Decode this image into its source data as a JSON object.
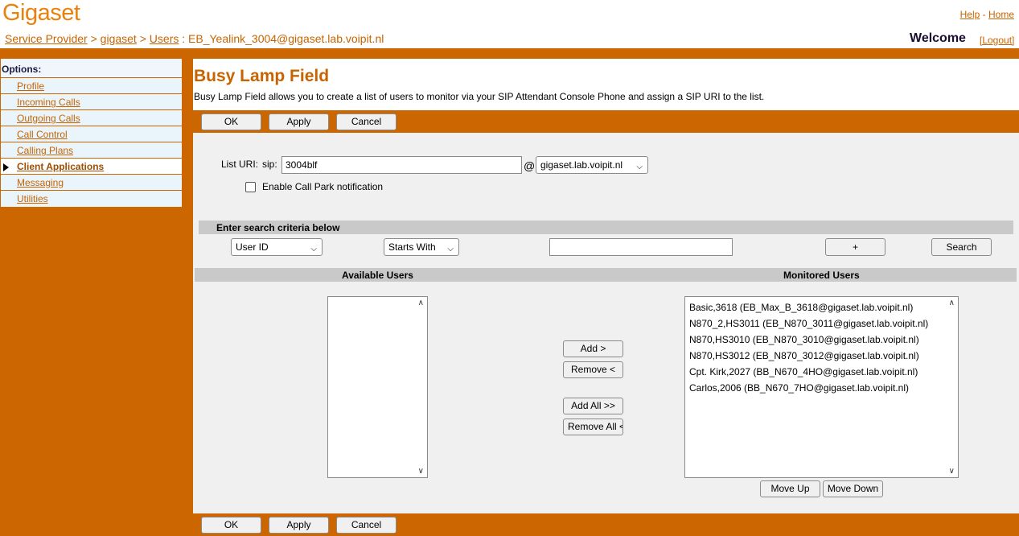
{
  "brand": {
    "logo_text": "Gigaset"
  },
  "top_links": {
    "help": "Help",
    "separator": "-",
    "home": "Home"
  },
  "breadcrumb": {
    "service_provider": "Service Provider",
    "sep1": ">",
    "gigaset": "gigaset",
    "sep2": ">",
    "users": "Users",
    "current": ": EB_Yealink_3004@gigaset.lab.voipit.nl"
  },
  "welcome": "Welcome",
  "logout": "[Logout]",
  "sidebar": {
    "title": "Options:",
    "items": [
      {
        "label": "Profile"
      },
      {
        "label": "Incoming Calls"
      },
      {
        "label": "Outgoing Calls"
      },
      {
        "label": "Call Control"
      },
      {
        "label": "Calling Plans"
      },
      {
        "label": "Client Applications"
      },
      {
        "label": "Messaging"
      },
      {
        "label": "Utilities"
      }
    ]
  },
  "page": {
    "title": "Busy Lamp Field",
    "description": "Busy Lamp Field allows you to create a list of users to monitor via your SIP Attendant Console Phone and assign a SIP URI to the list."
  },
  "buttons": {
    "ok": "OK",
    "apply": "Apply",
    "cancel": "Cancel"
  },
  "form": {
    "list_uri_label": "List URI:",
    "sip_label": "sip:",
    "sip_value": "3004blf",
    "at": "@",
    "domain_value": "gigaset.lab.voipit.nl",
    "call_park_label": "Enable Call Park notification"
  },
  "search": {
    "header": "Enter search criteria below",
    "field_value": "User ID",
    "mode_value": "Starts With",
    "text_value": "",
    "plus_label": "+",
    "search_label": "Search"
  },
  "users": {
    "available_header": "Available Users",
    "monitored_header": "Monitored Users",
    "monitored": [
      "Basic,3618 (EB_Max_B_3618@gigaset.lab.voipit.nl)",
      "N870_2,HS3011 (EB_N870_3011@gigaset.lab.voipit.nl)",
      "N870,HS3010 (EB_N870_3010@gigaset.lab.voipit.nl)",
      "N870,HS3012 (EB_N870_3012@gigaset.lab.voipit.nl)",
      "Cpt. Kirk,2027 (BB_N670_4HO@gigaset.lab.voipit.nl)",
      "Carlos,2006 (BB_N670_7HO@gigaset.lab.voipit.nl)"
    ],
    "add": "Add >",
    "remove": "Remove <",
    "add_all": "Add All >>",
    "remove_all": "Remove All <<",
    "move_up": "Move Up",
    "move_down": "Move Down"
  }
}
